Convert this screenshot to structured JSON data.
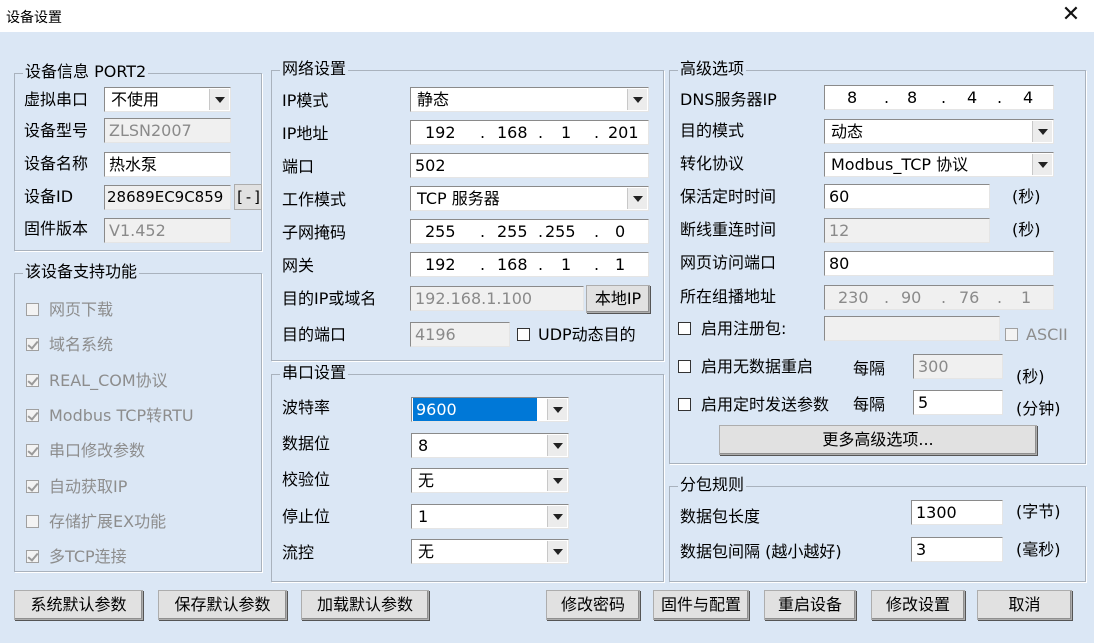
{
  "window": {
    "title": "设备设置",
    "close_glyph": "✕"
  },
  "device_info": {
    "group_label": "设备信息 PORT2",
    "virtual_port_label": "虚拟串口",
    "virtual_port_value": "不使用",
    "model_label": "设备型号",
    "model_value": "ZLSN2007",
    "name_label": "设备名称",
    "name_value": "热水泵",
    "id_label": "设备ID",
    "id_value": "28689EC9C859",
    "id_button": "[-]",
    "firmware_label": "固件版本",
    "firmware_value": "V1.452"
  },
  "features": {
    "group_label": "该设备支持功能",
    "items": [
      {
        "label": "网页下载",
        "checked": false
      },
      {
        "label": "域名系统",
        "checked": true
      },
      {
        "label": "REAL_COM协议",
        "checked": true
      },
      {
        "label": "Modbus TCP转RTU",
        "checked": true
      },
      {
        "label": "串口修改参数",
        "checked": true
      },
      {
        "label": "自动获取IP",
        "checked": true
      },
      {
        "label": "存储扩展EX功能",
        "checked": false
      },
      {
        "label": "多TCP连接",
        "checked": true
      }
    ]
  },
  "network": {
    "group_label": "网络设置",
    "ip_mode_label": "IP模式",
    "ip_mode_value": "静态",
    "ip_label": "IP地址",
    "ip_value": [
      "192",
      "168",
      "1",
      "201"
    ],
    "port_label": "端口",
    "port_value": "502",
    "work_mode_label": "工作模式",
    "work_mode_value": "TCP 服务器",
    "subnet_label": "子网掩码",
    "subnet_value": [
      "255",
      "255",
      "255",
      "0"
    ],
    "gateway_label": "网关",
    "gateway_value": [
      "192",
      "168",
      "1",
      "1"
    ],
    "dest_ip_label": "目的IP或域名",
    "dest_ip_value": "192.168.1.100",
    "local_ip_button": "本地IP",
    "dest_port_label": "目的端口",
    "dest_port_value": "4196",
    "udp_dynamic_label": "UDP动态目的"
  },
  "serial": {
    "group_label": "串口设置",
    "baud_label": "波特率",
    "baud_value": "9600",
    "databits_label": "数据位",
    "databits_value": "8",
    "parity_label": "校验位",
    "parity_value": "无",
    "stopbits_label": "停止位",
    "stopbits_value": "1",
    "flow_label": "流控",
    "flow_value": "无"
  },
  "advanced": {
    "group_label": "高级选项",
    "dns_label": "DNS服务器IP",
    "dns_value": [
      "8",
      "8",
      "4",
      "4"
    ],
    "dest_mode_label": "目的模式",
    "dest_mode_value": "动态",
    "protocol_label": "转化协议",
    "protocol_value": "Modbus_TCP 协议",
    "keepalive_label": "保活定时时间",
    "keepalive_value": "60",
    "keepalive_unit": "(秒)",
    "reconnect_label": "断线重连时间",
    "reconnect_value": "12",
    "reconnect_unit": "(秒)",
    "web_port_label": "网页访问端口",
    "web_port_value": "80",
    "multicast_label": "所在组播地址",
    "multicast_value": [
      "230",
      "90",
      "76",
      "1"
    ],
    "reg_packet_label": "启用注册包:",
    "reg_packet_value": "",
    "ascii_label": "ASCII",
    "nodata_restart_label": "启用无数据重启",
    "nodata_interval_label": "每隔",
    "nodata_interval_value": "300",
    "nodata_unit": "(秒)",
    "timed_send_label": "启用定时发送参数",
    "timed_interval_label": "每隔",
    "timed_interval_value": "5",
    "timed_unit": "(分钟)",
    "more_button": "更多高级选项..."
  },
  "packet": {
    "group_label": "分包规则",
    "length_label": "数据包长度",
    "length_value": "1300",
    "length_unit": "(字节)",
    "interval_label": "数据包间隔 (越小越好)",
    "interval_value": "3",
    "interval_unit": "(毫秒)"
  },
  "buttons": {
    "system_default": "系统默认参数",
    "save_default": "保存默认参数",
    "load_default": "加载默认参数",
    "change_password": "修改密码",
    "firmware_config": "固件与配置",
    "restart": "重启设备",
    "modify": "修改设置",
    "cancel": "取消"
  }
}
